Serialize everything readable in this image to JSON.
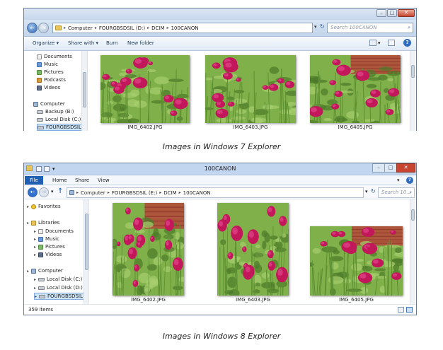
{
  "captions": {
    "win7": "Images in Windows 7 Explorer",
    "win8": "Images in Windows 8 Explorer"
  },
  "icons": {
    "back": "←",
    "forward": "→",
    "up": "↑",
    "refresh": "↻",
    "dropdown": "▾",
    "expand": "▸",
    "breadcrumb_sep": "▸",
    "search": "⌕",
    "help": "?",
    "minimize": "–",
    "maximize": "□",
    "close": "✕"
  },
  "win7": {
    "address": {
      "crumbs": [
        "Computer",
        "FOURGBSDSIL (D:)",
        "DCIM",
        "100CANON"
      ]
    },
    "search_placeholder": "Search 100CANON",
    "toolbar": {
      "organize": "Organize",
      "share_with": "Share with",
      "burn": "Burn",
      "new_folder": "New folder"
    },
    "nav": {
      "items": [
        "Documents",
        "Music",
        "Pictures",
        "Podcasts",
        "Videos"
      ],
      "computer": "Computer",
      "drives": [
        "Backup (B:)",
        "Local Disk (C:)",
        "FOURGBSDSIL (D"
      ]
    },
    "files": [
      "IMG_6402.JPG",
      "IMG_6403.JPG",
      "IMG_6405.JPG"
    ]
  },
  "win8": {
    "title": "100CANON",
    "ribbon": {
      "file": "File",
      "tabs": [
        "Home",
        "Share",
        "View"
      ]
    },
    "address": {
      "crumbs": [
        "Computer",
        "FOURGBSDSIL (E:)",
        "DCIM",
        "100CANON"
      ]
    },
    "search_placeholder": "Search 10...",
    "nav": {
      "favorites": "Favorites",
      "libraries": "Libraries",
      "library_items": [
        "Documents",
        "Music",
        "Pictures",
        "Videos"
      ],
      "computer": "Computer",
      "drives": [
        "Local Disk (C:)",
        "Local Disk (D:)",
        "FOURGBSDSIL (E:)"
      ]
    },
    "files": [
      "IMG_6402.JPG",
      "IMG_6403.JPG",
      "IMG_6405.JPG"
    ],
    "status": "359 items"
  },
  "colors": {
    "flower": "#c2185b",
    "flower_light": "#e0468a",
    "foliage": "#7fb04a",
    "foliage_dark": "#4d7a2a",
    "roof": "#b4463a",
    "selection": "#cde4f7",
    "accent": "#1f5fb4"
  }
}
